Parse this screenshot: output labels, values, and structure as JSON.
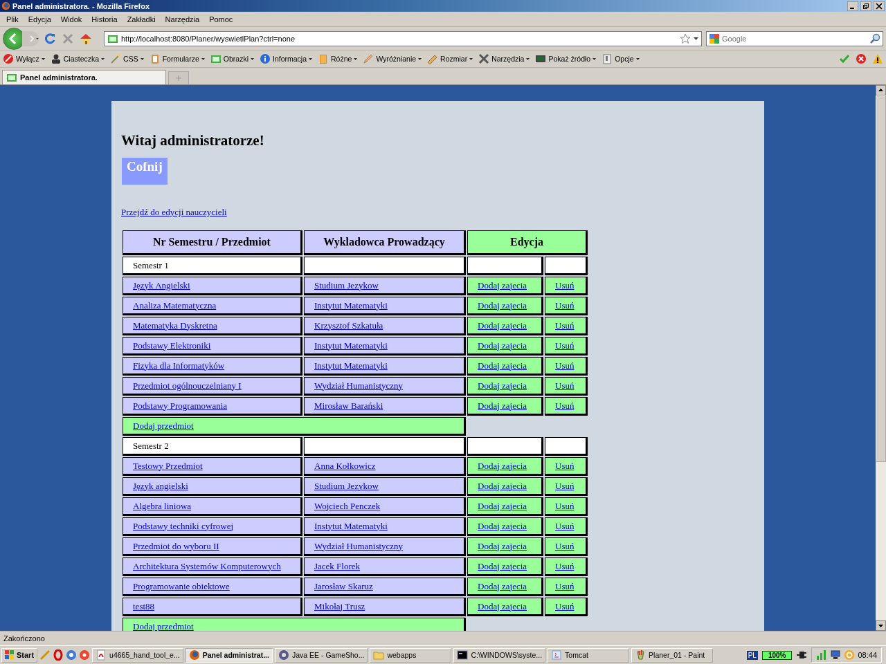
{
  "window": {
    "title": "Panel administratora. - Mozilla Firefox"
  },
  "menu": [
    "Plik",
    "Edycja",
    "Widok",
    "Historia",
    "Zakładki",
    "Narzędzia",
    "Pomoc"
  ],
  "address": {
    "value": "http://localhost:8080/Planer/wyswietlPlan?ctrl=none"
  },
  "search": {
    "placeholder": "Google"
  },
  "dev_toolbar": [
    "Wyłącz",
    "Ciasteczka",
    "CSS",
    "Formularze",
    "Obrazki",
    "Informacja",
    "Różne",
    "Wyróżnianie",
    "Rozmiar",
    "Narzędzia",
    "Pokaż źródło",
    "Opcje"
  ],
  "tabs": [
    {
      "label": "Panel administratora.",
      "selected": true
    }
  ],
  "page": {
    "heading": "Witaj administratorze!",
    "back_button": "Cofnij",
    "teachers_link": "Przejdź do edycji nauczycieli",
    "table": {
      "columns": [
        "Nr Semestru / Przedmiot",
        "Wykladowca Prowadzący",
        "Edycja"
      ],
      "semesters": [
        {
          "label": "Semestr 1",
          "add_subject": "Dodaj przedmiot",
          "subjects": [
            {
              "name": "Język Angielski",
              "teacher": "Studium Jezykow",
              "add": "Dodaj zajecia",
              "delete": "Usuń"
            },
            {
              "name": "Analiza Matematyczna",
              "teacher": "Instytut Matematyki",
              "add": "Dodaj zajecia",
              "delete": "Usuń"
            },
            {
              "name": "Matematyka Dyskretna",
              "teacher": "Krzysztof Szkatuła",
              "add": "Dodaj zajecia",
              "delete": "Usuń"
            },
            {
              "name": "Podstawy Elektroniki",
              "teacher": "Instytut Matematyki",
              "add": "Dodaj zajecia",
              "delete": "Usuń"
            },
            {
              "name": "Fizyka dla Informatyków",
              "teacher": "Instytut Matematyki",
              "add": "Dodaj zajecia",
              "delete": "Usuń"
            },
            {
              "name": "Przedmiot ogólnouczelniany I",
              "teacher": "Wydział Humanistyczny",
              "add": "Dodaj zajecia",
              "delete": "Usuń"
            },
            {
              "name": "Podstawy Programowania",
              "teacher": "Mirosław Barański",
              "add": "Dodaj zajecia",
              "delete": "Usuń"
            }
          ]
        },
        {
          "label": "Semestr 2",
          "add_subject": "Dodaj przedmiot",
          "subjects": [
            {
              "name": "Testowy Przedmiot",
              "teacher": "Anna Kołkowicz",
              "add": "Dodaj zajecia",
              "delete": "Usuń"
            },
            {
              "name": "Język angielski",
              "teacher": "Studium Jezykow",
              "add": "Dodaj zajecia",
              "delete": "Usuń"
            },
            {
              "name": "Algebra liniowa",
              "teacher": "Wojciech Penczek",
              "add": "Dodaj zajecia",
              "delete": "Usuń"
            },
            {
              "name": "Podstawy techniki cyfrowej",
              "teacher": "Instytut Matematyki",
              "add": "Dodaj zajecia",
              "delete": "Usuń"
            },
            {
              "name": "Przedmiot do wyboru II",
              "teacher": "Wydział Humanistyczny",
              "add": "Dodaj zajecia",
              "delete": "Usuń"
            },
            {
              "name": "Architektura Systemów Komputerowych",
              "teacher": "Jacek Florek",
              "add": "Dodaj zajecia",
              "delete": "Usuń"
            },
            {
              "name": "Programowanie obiektowe",
              "teacher": "Jarosław Skaruz",
              "add": "Dodaj zajecia",
              "delete": "Usuń"
            },
            {
              "name": "test88",
              "teacher": "Mikołaj Trusz",
              "add": "Dodaj zajecia",
              "delete": "Usuń"
            }
          ]
        }
      ]
    }
  },
  "status_bar": {
    "text": "Zakończono"
  },
  "taskbar": {
    "start": "Start",
    "tasks": [
      {
        "label": "u4665_hand_tool_e...",
        "selected": false
      },
      {
        "label": "Panel administrat...",
        "selected": true
      },
      {
        "label": "Java EE - GameSho...",
        "selected": false
      },
      {
        "label": "webapps",
        "selected": false
      },
      {
        "label": "C:\\WINDOWS\\syste...",
        "selected": false
      },
      {
        "label": "Tomcat",
        "selected": false
      },
      {
        "label": "Planer_01 - Paint",
        "selected": false
      }
    ],
    "language": "PL",
    "battery": "100%",
    "clock": "08:44"
  }
}
